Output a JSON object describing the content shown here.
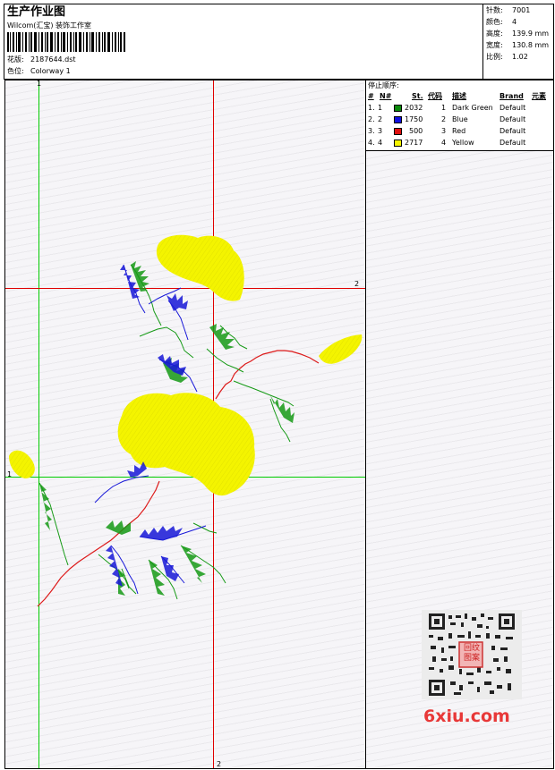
{
  "header": {
    "title": "生产作业图",
    "studio": "Wilcom(汇宝) 装饰工作室",
    "barcode_icon": "barcode-icon",
    "design_label": "花版:",
    "design_file": "2187644.dst",
    "colorway_label": "色位:",
    "colorway": "Colorway 1"
  },
  "stats": [
    {
      "label": "针数:",
      "value": "7001"
    },
    {
      "label": "颜色:",
      "value": "4"
    },
    {
      "label": "高度:",
      "value": "139.9 mm"
    },
    {
      "label": "宽度:",
      "value": "130.8 mm"
    },
    {
      "label": "比例:",
      "value": "1.02"
    }
  ],
  "stop_sequence": {
    "title": "停止顺序:",
    "headers": [
      "#",
      "N#",
      "St.",
      "代码",
      "描述",
      "Brand",
      "元素"
    ],
    "rows": [
      {
        "index": "1.",
        "n": "1",
        "color": "#0a8a0a",
        "stitches": "2032",
        "code": "1",
        "desc": "Dark Green",
        "brand": "Default"
      },
      {
        "index": "2.",
        "n": "2",
        "color": "#1010e0",
        "stitches": "1750",
        "code": "2",
        "desc": "Blue",
        "brand": "Default"
      },
      {
        "index": "3.",
        "n": "3",
        "color": "#e01010",
        "stitches": "500",
        "code": "3",
        "desc": "Red",
        "brand": "Default"
      },
      {
        "index": "4.",
        "n": "4",
        "color": "#f5f500",
        "stitches": "2717",
        "code": "4",
        "desc": "Yellow",
        "brand": "Default"
      }
    ]
  },
  "guides": {
    "label_1": "1",
    "label_2": "2",
    "green": "#00cc00",
    "red": "#e00000"
  },
  "watermark": {
    "qr_icon": "qr-code-icon",
    "seal_text": "回纹图案",
    "site": "6xiu.com"
  },
  "thread_colors": {
    "dark_green": "#169a16",
    "blue": "#1818d8",
    "red": "#dd1a1a",
    "yellow": "#f4f400"
  }
}
